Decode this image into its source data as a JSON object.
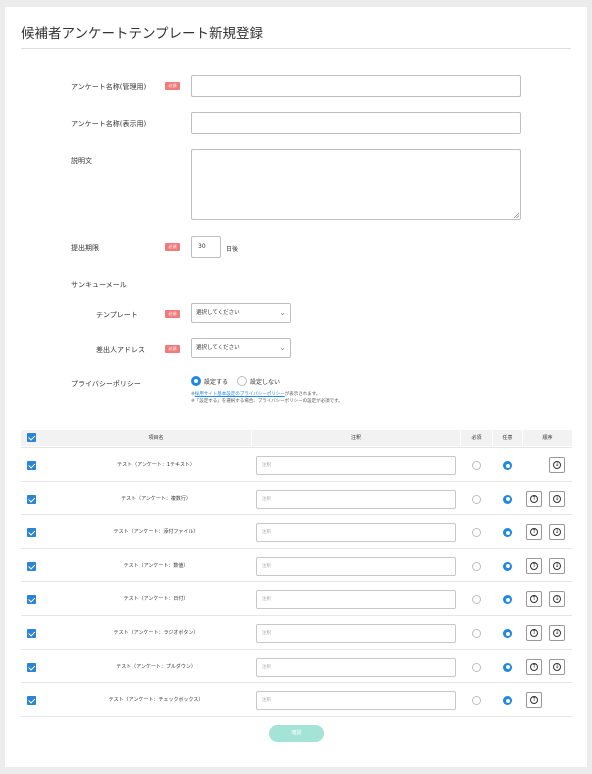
{
  "page": {
    "title": "候補者アンケートテンプレート新規登録"
  },
  "form": {
    "required_badge": "必須",
    "name_admin": {
      "label": "アンケート名称(管理用)",
      "value": ""
    },
    "name_display": {
      "label": "アンケート名称(表示用)",
      "value": ""
    },
    "description": {
      "label": "説明文",
      "value": ""
    },
    "deadline": {
      "label": "提出期限",
      "value": "30",
      "suffix": "日後"
    },
    "thanks_mail": {
      "label": "サンキューメール"
    },
    "template": {
      "label": "テンプレート",
      "value": "選択してください"
    },
    "sender": {
      "label": "差出人アドレス",
      "value": "選択してください"
    },
    "privacy": {
      "label": "プライバシーポリシー",
      "option_on": "設定する",
      "option_off": "設定しない",
      "selected": "設定する",
      "note1_prefix": "※",
      "note1_link": "採用サイト基本設定のプライバシーポリシー",
      "note1_suffix": "が表示されます。",
      "note2": "※「設定する」を選択する場合、プライバシーポリシーの設定が必須です。"
    }
  },
  "table": {
    "headers": {
      "item": "項目名",
      "note": "注釈",
      "required": "必須",
      "optional": "任意",
      "order": "順序"
    },
    "note_placeholder": "注釈",
    "rows": [
      {
        "name": "テスト（アンケート：1テキスト）",
        "checked": true,
        "mode": "optional",
        "up": false,
        "down": true
      },
      {
        "name": "テスト（アンケート：複数行）",
        "checked": true,
        "mode": "optional",
        "up": true,
        "down": true
      },
      {
        "name": "テスト（アンケート：添付ファイル）",
        "checked": true,
        "mode": "optional",
        "up": true,
        "down": true
      },
      {
        "name": "テスト（アンケート：数値）",
        "checked": true,
        "mode": "optional",
        "up": true,
        "down": true
      },
      {
        "name": "テスト（アンケート：日付）",
        "checked": true,
        "mode": "optional",
        "up": true,
        "down": true
      },
      {
        "name": "テスト（アンケート：ラジオボタン）",
        "checked": true,
        "mode": "optional",
        "up": true,
        "down": true
      },
      {
        "name": "テスト（アンケート：プルダウン）",
        "checked": true,
        "mode": "optional",
        "up": true,
        "down": true
      },
      {
        "name": "テスト（アンケート：チェックボックス）",
        "checked": true,
        "mode": "optional",
        "up": true,
        "down": false
      }
    ]
  },
  "buttons": {
    "confirm": "確認"
  },
  "colors": {
    "accent": "#1e88e5",
    "required_badge": "#f07b7b",
    "confirm_button": "#a3e4d7",
    "checkbox": "#2b84d4"
  }
}
